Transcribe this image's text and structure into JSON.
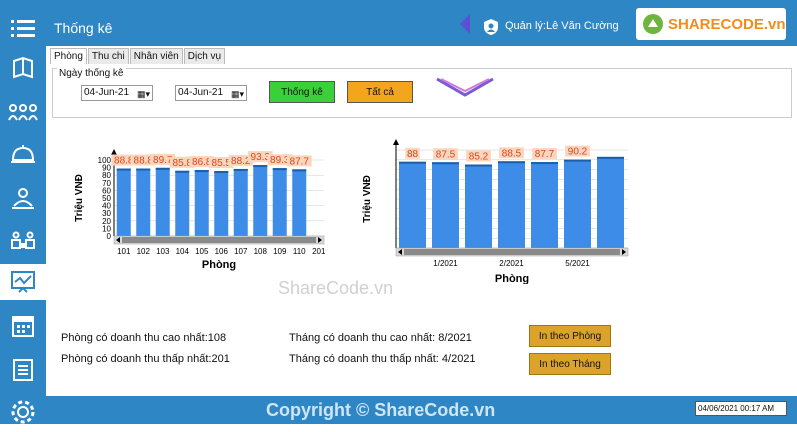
{
  "window_title": "Thống kê",
  "user_label": "Quản lý:Lê Văn Cường",
  "logo_text": "SHARECODE.vn",
  "tabs": [
    "Phòng",
    "Thu chi",
    "Nhân viên",
    "Dịch vụ"
  ],
  "filter": {
    "label": "Ngày thống kê",
    "from_date": "04-Jun-21",
    "to_date": "04-Jun-21",
    "stat_button": "Thống kê",
    "all_button": "Tất cả"
  },
  "colors": {
    "accent": "#2f86c4",
    "bar": "#3d8ce8",
    "stat_btn": "#3ad03a",
    "all_btn": "#f3a61b",
    "print_btn": "#dba32a"
  },
  "chart_data": [
    {
      "type": "bar",
      "xlabel": "Phòng",
      "ylabel": "Triệu VNĐ",
      "ylim": [
        0,
        100
      ],
      "yticks": [
        0,
        10,
        20,
        30,
        40,
        50,
        60,
        70,
        80,
        90,
        100
      ],
      "categories": [
        "101",
        "102",
        "103",
        "104",
        "105",
        "106",
        "107",
        "108",
        "109",
        "110",
        "201"
      ],
      "values": [
        88.8,
        88.8,
        89.7,
        85.8,
        86.8,
        85.5,
        88.2,
        93.3,
        89.3,
        87.7,
        null
      ],
      "labels": [
        "88.8",
        "88.8",
        "89.7",
        "85.8",
        "86.8",
        "85.5",
        "88.2",
        "93.3",
        "89.3",
        "87.7"
      ]
    },
    {
      "type": "bar",
      "xlabel": "Phòng",
      "ylabel": "Triệu VNĐ",
      "ylim": [
        0,
        100
      ],
      "yticks": [
        0,
        10,
        20,
        30,
        40,
        50,
        60,
        70,
        80,
        90,
        100
      ],
      "categories": [
        "",
        "1/2021",
        "",
        "2/2021",
        "",
        "5/2021",
        ""
      ],
      "values": [
        88,
        87.5,
        85.2,
        88.5,
        87.7,
        90.2,
        93
      ],
      "labels": [
        "88",
        "87.5",
        "85.2",
        "88.5",
        "87.7",
        "90.2",
        ""
      ]
    }
  ],
  "summary": {
    "room_max": "Phòng có doanh thu cao nhất:108",
    "room_min": "Phòng có doanh thu thấp nhất:201",
    "month_max": "Tháng có doanh thu cao nhất: 8/2021",
    "month_min": "Tháng có doanh thu thấp nhất: 4/2021",
    "print_room": "In theo Phòng",
    "print_month": "In theo Tháng"
  },
  "watermark": "ShareCode.vn",
  "copyright": "Copyright © ShareCode.vn",
  "footer_date": "04/06/2021 00:17 AM"
}
